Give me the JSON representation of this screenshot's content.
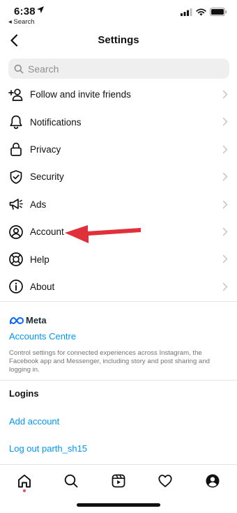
{
  "status_bar": {
    "time": "6:38",
    "back_app": "◂ Search"
  },
  "header": {
    "title": "Settings"
  },
  "search": {
    "placeholder": "Search"
  },
  "menu_items": [
    {
      "label": "Follow and invite friends",
      "icon": "add-person-icon"
    },
    {
      "label": "Notifications",
      "icon": "bell-icon"
    },
    {
      "label": "Privacy",
      "icon": "lock-icon"
    },
    {
      "label": "Security",
      "icon": "shield-icon"
    },
    {
      "label": "Ads",
      "icon": "megaphone-icon"
    },
    {
      "label": "Account",
      "icon": "account-circle-icon"
    },
    {
      "label": "Help",
      "icon": "lifebuoy-icon"
    },
    {
      "label": "About",
      "icon": "info-icon"
    }
  ],
  "meta_section": {
    "logo_text": "Meta",
    "link": "Accounts Centre",
    "description": "Control settings for connected experiences across Instagram, the Facebook app and Messenger, including story and post sharing and logging in."
  },
  "logins": {
    "title": "Logins",
    "add_account": "Add account",
    "logout": "Log out parth_sh15"
  },
  "tab_bar": [
    {
      "name": "home-icon"
    },
    {
      "name": "search-icon"
    },
    {
      "name": "reels-icon"
    },
    {
      "name": "heart-icon"
    },
    {
      "name": "profile-icon"
    }
  ],
  "colors": {
    "link": "#0095f6",
    "annotation_arrow": "#e0303a",
    "notification_dot": "#ed4956"
  }
}
